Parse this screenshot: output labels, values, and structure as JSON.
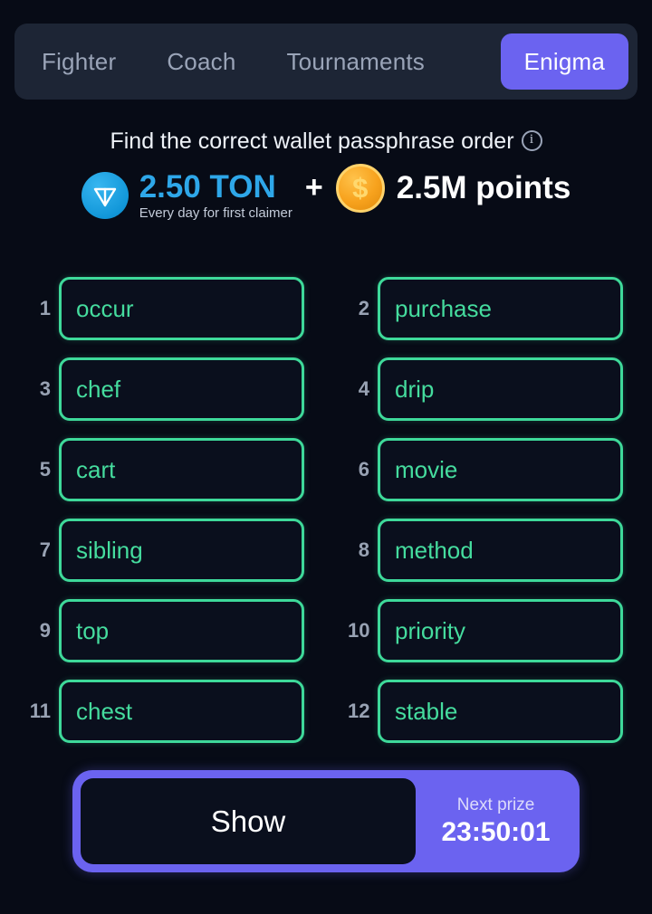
{
  "theme": {
    "background": "#070b16",
    "accent_purple": "#6b63f0",
    "accent_green": "#3ed99a",
    "accent_blue": "#2ea7e9",
    "coin_orange": "#f7a21d",
    "muted_text": "#98a2b3"
  },
  "tabs": [
    {
      "label": "Fighter",
      "active": false
    },
    {
      "label": "Coach",
      "active": false
    },
    {
      "label": "Tournaments",
      "active": false
    },
    {
      "label": "Enigma",
      "active": true
    }
  ],
  "header": {
    "title": "Find the correct wallet passphrase order",
    "info_icon": "info-circle-icon"
  },
  "prize": {
    "ton_icon": "ton-logo-icon",
    "ton_amount": "2.50 TON",
    "ton_subtitle": "Every day for first claimer",
    "separator": "+",
    "coin_icon": "dollar-coin-icon",
    "points_amount": "2.5M points"
  },
  "grid": {
    "words": [
      {
        "number": "1",
        "word": "occur"
      },
      {
        "number": "2",
        "word": "purchase"
      },
      {
        "number": "3",
        "word": "chef"
      },
      {
        "number": "4",
        "word": "drip"
      },
      {
        "number": "5",
        "word": "cart"
      },
      {
        "number": "6",
        "word": "movie"
      },
      {
        "number": "7",
        "word": "sibling"
      },
      {
        "number": "8",
        "word": "method"
      },
      {
        "number": "9",
        "word": "top"
      },
      {
        "number": "10",
        "word": "priority"
      },
      {
        "number": "11",
        "word": "chest"
      },
      {
        "number": "12",
        "word": "stable"
      }
    ]
  },
  "bottom": {
    "show_label": "Show",
    "next_prize_label": "Next prize",
    "next_prize_time": "23:50:01"
  }
}
